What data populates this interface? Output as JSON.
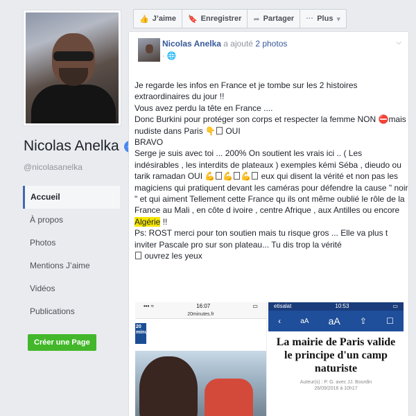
{
  "profile": {
    "name": "Nicolas Anelka",
    "handle": "@nicolasanelka",
    "verified_mark": "✓"
  },
  "nav": {
    "items": [
      {
        "label": "Accueil",
        "active": true
      },
      {
        "label": "À propos"
      },
      {
        "label": "Photos"
      },
      {
        "label": "Mentions J’aime"
      },
      {
        "label": "Vidéos"
      },
      {
        "label": "Publications"
      }
    ],
    "create_page": "Créer une Page"
  },
  "actions": {
    "like": "J’aime",
    "register": "Enregistrer",
    "share": "Partager",
    "more": "Plus"
  },
  "post": {
    "author": "Nicolas Anelka",
    "added": "a ajouté",
    "photos": "2 photos",
    "lines": {
      "l1": "Je regarde les infos en France et je tombe sur les 2 histoires extraordinaires du jour !!",
      "l2": "Vous avez perdu la tête en France ....",
      "l3a": "Donc Burkini pour protéger son corps et respecter la femme NON ",
      "l3b": "mais nudiste dans Paris ",
      "l3c": " OUI",
      "l4": "BRAVO",
      "l5": "Serge je suis avec toi ... 200% On soutient les vrais ici .. ( Les indésirables , les interdits de plateaux ) exemples kémi Séba , dieudo ou tarik ramadan OUI ",
      "l5b": " eux qui disent la vérité et non pas les magiciens qui pratiquent devant les caméras pour défendre la cause \" noir \" et qui aiment Tellement cette France qu ils ont même oublié le rôle de la France au Mali , en côte d ivoire , centre Afrique , aux Antilles ou encore ",
      "highlight": "Algérie",
      "l5c": " !!",
      "l6": "Ps: ROST merci pour ton soutien mais tu risque gros ... Elle va plus t inviter Pascale pro sur son plateau... Tu dis trop la vérité",
      "l7": " ouvrez les yeux"
    },
    "images": {
      "left": {
        "time": "16:07",
        "url": "20minutes.fr",
        "logo": "20 minutes"
      },
      "right": {
        "carrier": "etisalat",
        "time": "10:53",
        "headline": "La mairie de Paris valide le principe d'un camp naturiste",
        "byline1": "Auteur(s) : P. G. avec JJ. Bourdin",
        "byline2": "26/09/2016 à 10h17"
      }
    }
  }
}
